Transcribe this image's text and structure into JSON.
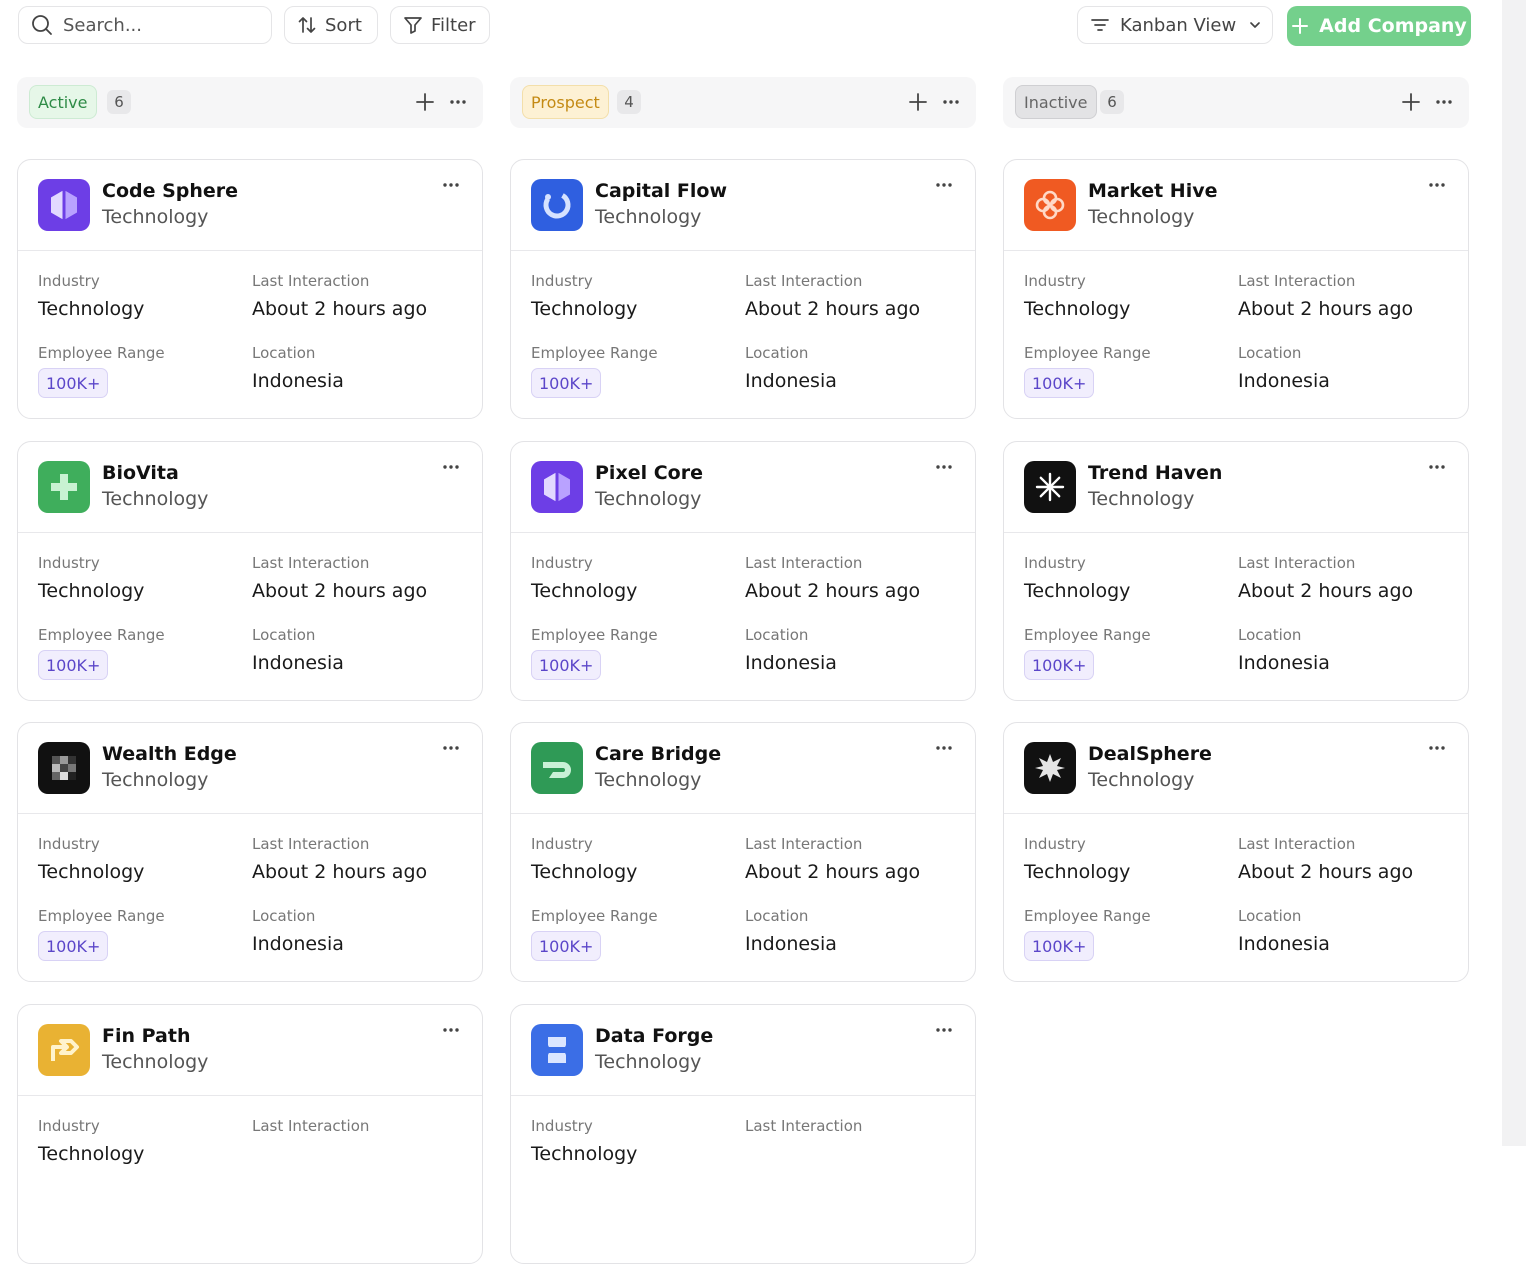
{
  "toolbar": {
    "search_placeholder": "Search...",
    "sort_label": "Sort",
    "filter_label": "Filter",
    "view_label": "Kanban View",
    "add_label": "Add Company"
  },
  "field_labels": {
    "industry": "Industry",
    "last_interaction": "Last Interaction",
    "employee_range": "Employee Range",
    "location": "Location"
  },
  "colors": {
    "accent": "#74d08c",
    "active": "#2e8b46",
    "prospect": "#c48a14",
    "inactive": "#666666"
  },
  "columns": [
    {
      "status": "Active",
      "count": "6",
      "cards": [
        {
          "name": "Code Sphere",
          "category": "Technology",
          "industry": "Technology",
          "last_interaction": "About 2 hours ago",
          "employee_range": "100K+",
          "location": "Indonesia",
          "logo": "purple-hexagon-logo"
        },
        {
          "name": "BioVita",
          "category": "Technology",
          "industry": "Technology",
          "last_interaction": "About 2 hours ago",
          "employee_range": "100K+",
          "location": "Indonesia",
          "logo": "green-cross-logo"
        },
        {
          "name": "Wealth Edge",
          "category": "Technology",
          "industry": "Technology",
          "last_interaction": "About 2 hours ago",
          "employee_range": "100K+",
          "location": "Indonesia",
          "logo": "black-pixel-logo"
        },
        {
          "name": "Fin Path",
          "category": "Technology",
          "industry": "Technology",
          "last_interaction": "",
          "employee_range": "",
          "location": "",
          "logo": "yellow-arrow-logo"
        }
      ]
    },
    {
      "status": "Prospect",
      "count": "4",
      "cards": [
        {
          "name": "Capital Flow",
          "category": "Technology",
          "industry": "Technology",
          "last_interaction": "About 2 hours ago",
          "employee_range": "100K+",
          "location": "Indonesia",
          "logo": "blue-ring-logo"
        },
        {
          "name": "Pixel Core",
          "category": "Technology",
          "industry": "Technology",
          "last_interaction": "About 2 hours ago",
          "employee_range": "100K+",
          "location": "Indonesia",
          "logo": "purple-hexagon-logo"
        },
        {
          "name": "Care Bridge",
          "category": "Technology",
          "industry": "Technology",
          "last_interaction": "About 2 hours ago",
          "employee_range": "100K+",
          "location": "Indonesia",
          "logo": "green-bridge-logo"
        },
        {
          "name": "Data Forge",
          "category": "Technology",
          "industry": "Technology",
          "last_interaction": "",
          "employee_range": "",
          "location": "",
          "logo": "blue-hourglass-logo"
        }
      ]
    },
    {
      "status": "Inactive",
      "count": "6",
      "cards": [
        {
          "name": "Market Hive",
          "category": "Technology",
          "industry": "Technology",
          "last_interaction": "About 2 hours ago",
          "employee_range": "100K+",
          "location": "Indonesia",
          "logo": "orange-flower-logo"
        },
        {
          "name": "Trend Haven",
          "category": "Technology",
          "industry": "Technology",
          "last_interaction": "About 2 hours ago",
          "employee_range": "100K+",
          "location": "Indonesia",
          "logo": "black-asterisk-logo"
        },
        {
          "name": "DealSphere",
          "category": "Technology",
          "industry": "Technology",
          "last_interaction": "About 2 hours ago",
          "employee_range": "100K+",
          "location": "Indonesia",
          "logo": "black-starburst-logo"
        }
      ]
    }
  ]
}
